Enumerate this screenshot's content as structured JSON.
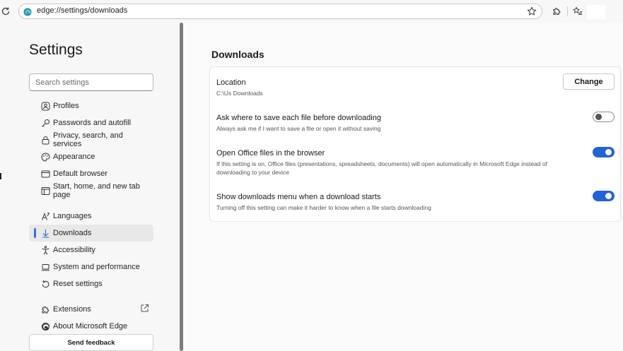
{
  "browser": {
    "url": "edge://settings/downloads"
  },
  "sidebar": {
    "title": "Settings",
    "search_placeholder": "Search settings",
    "items": [
      {
        "label": "Profiles",
        "icon": "profile-icon"
      },
      {
        "label": "Passwords and autofill",
        "icon": "key-icon"
      },
      {
        "label": "Privacy, search, and services",
        "icon": "lock-icon"
      },
      {
        "label": "Appearance",
        "icon": "palette-icon"
      },
      {
        "label": "Default browser",
        "icon": "browser-icon"
      },
      {
        "label": "Start, home, and new tab page",
        "icon": "home-page-icon"
      },
      {
        "label": "Languages",
        "icon": "languages-icon"
      },
      {
        "label": "Downloads",
        "icon": "download-icon",
        "active": true
      },
      {
        "label": "Accessibility",
        "icon": "accessibility-icon"
      },
      {
        "label": "System and performance",
        "icon": "laptop-icon"
      },
      {
        "label": "Reset settings",
        "icon": "reset-icon"
      },
      {
        "label": "Extensions",
        "icon": "puzzle-icon"
      },
      {
        "label": "About Microsoft Edge",
        "icon": "edge-logo-icon"
      }
    ],
    "feedback_label": "Send feedback"
  },
  "main": {
    "title": "Downloads",
    "location": {
      "title": "Location",
      "path": "C:\\Us            Downloads",
      "button_label": "Change"
    },
    "settings": [
      {
        "title": "Ask where to save each file before downloading",
        "description": "Always ask me if I want to save a file or open it without saving",
        "enabled": false
      },
      {
        "title": "Open Office files in the browser",
        "description": "If this setting is on, Office files (presentations, spreadsheets, documents) will open automatically in Microsoft Edge instead of downloading to your device",
        "enabled": true
      },
      {
        "title": "Show downloads menu when a download starts",
        "description": "Turning off this setting can make it harder to know when a file starts downloading",
        "enabled": true
      }
    ]
  },
  "colors": {
    "accent": "#1f63d6",
    "active_indicator": "#3a6fd8",
    "sidebar_bg": "#f7f7f7"
  }
}
